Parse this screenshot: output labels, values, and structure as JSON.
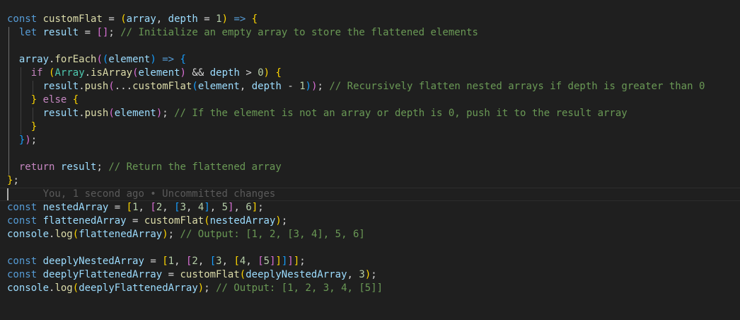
{
  "editor": {
    "background": "#1f1f1f",
    "lines": [
      "const customFlat = (array, depth = 1) => {",
      "  let result = []; // Initialize an empty array to store the flattened elements",
      "",
      "  array.forEach((element) => {",
      "    if (Array.isArray(element) && depth > 0) {",
      "      result.push(...customFlat(element, depth - 1)); // Recursively flatten nested arrays if depth is greater than 0",
      "    } else {",
      "      result.push(element); // If the element is not an array or depth is 0, push it to the result array",
      "    }",
      "  });",
      "",
      "  return result; // Return the flattened array",
      "};",
      "",
      "const nestedArray = [1, [2, [3, 4], 5], 6];",
      "const flattenedArray = customFlat(nestedArray);",
      "console.log(flattenedArray); // Output: [1, 2, [3, 4], 5, 6]",
      "",
      "const deeplyNestedArray = [1, [2, [3, [4, [5]]]]];",
      "const deeplyFlattenedArray = customFlat(deeplyNestedArray, 3);",
      "console.log(deeplyFlattenedArray); // Output: [1, 2, 3, 4, [5]]"
    ],
    "blame": "You, 1 second ago • Uncommitted changes"
  },
  "colors": {
    "keyword": "#569cd6",
    "control": "#c586c0",
    "function": "#dcdcaa",
    "variable": "#9cdcfe",
    "class": "#4ec9b0",
    "number": "#b5cea8",
    "comment": "#6a9955",
    "bracket1": "#ffd700",
    "bracket2": "#da70d6",
    "bracket3": "#179fff"
  }
}
